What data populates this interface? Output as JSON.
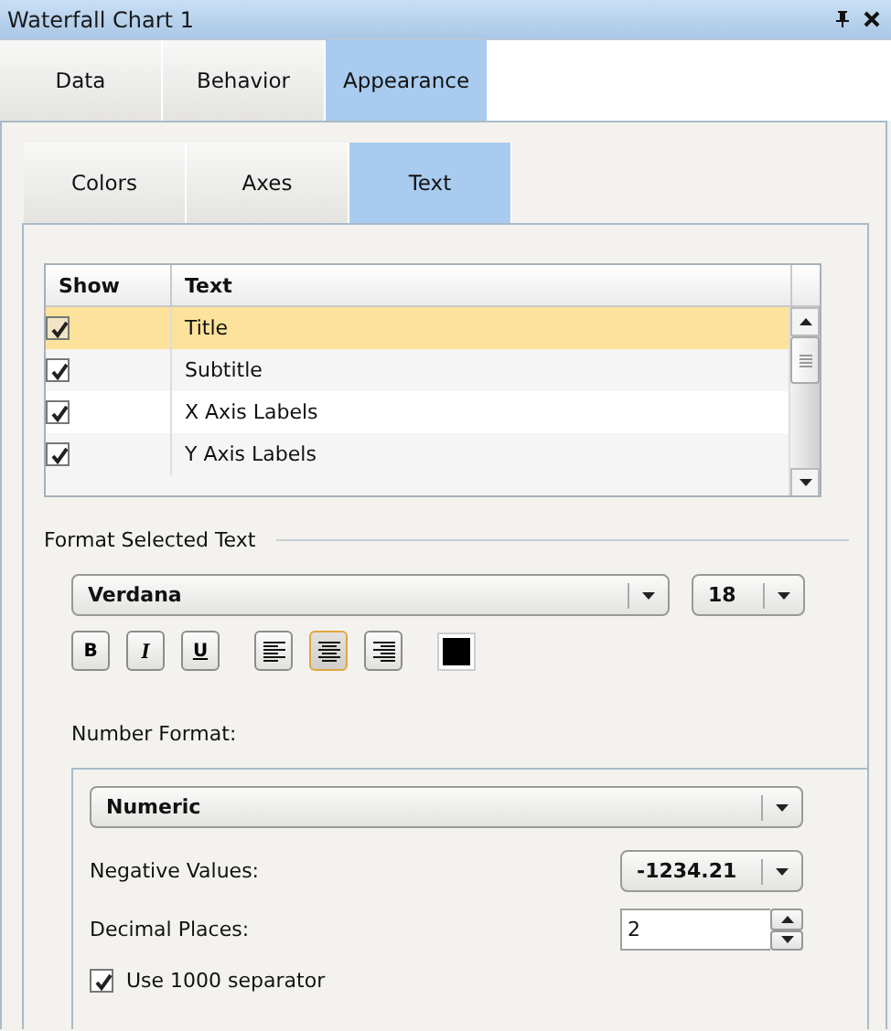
{
  "window": {
    "title": "Waterfall Chart 1"
  },
  "tabs": [
    {
      "label": "Data",
      "selected": false
    },
    {
      "label": "Behavior",
      "selected": false
    },
    {
      "label": "Appearance",
      "selected": true
    }
  ],
  "sub_tabs": [
    {
      "label": "Colors",
      "selected": false
    },
    {
      "label": "Axes",
      "selected": false
    },
    {
      "label": "Text",
      "selected": true
    }
  ],
  "text_grid": {
    "columns": [
      "Show",
      "Text"
    ],
    "rows": [
      {
        "show": true,
        "text": "Title",
        "selected": true
      },
      {
        "show": true,
        "text": "Subtitle",
        "selected": false
      },
      {
        "show": true,
        "text": "X Axis Labels",
        "selected": false
      },
      {
        "show": true,
        "text": "Y Axis Labels",
        "selected": false
      }
    ]
  },
  "format": {
    "heading": "Format Selected Text",
    "font": "Verdana",
    "size": "18",
    "style_buttons": [
      {
        "label": "B",
        "pressed": false
      },
      {
        "label": "I",
        "pressed": false
      },
      {
        "label": "U",
        "pressed": false
      }
    ],
    "alignment": [
      {
        "kind": "left",
        "selected": false
      },
      {
        "kind": "center",
        "selected": true
      },
      {
        "kind": "right",
        "selected": false
      }
    ],
    "color": "#000000"
  },
  "number_format": {
    "label": "Number Format:",
    "type": "Numeric",
    "negative_label": "Negative Values:",
    "negative_value": "-1234.21",
    "decimal_label": "Decimal Places:",
    "decimal_value": "2",
    "separator": {
      "label": "Use 1000 separator",
      "checked": true
    }
  }
}
